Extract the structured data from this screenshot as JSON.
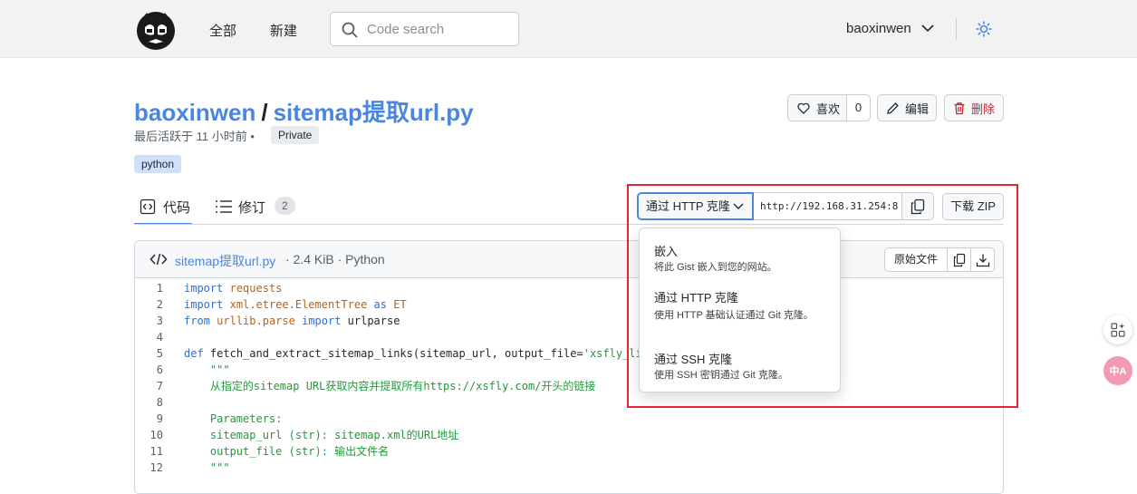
{
  "header": {
    "nav": [
      "全部",
      "新建"
    ],
    "search_placeholder": "Code search",
    "username": "baoxinwen"
  },
  "gist": {
    "owner": "baoxinwen",
    "separator": "/",
    "filename": "sitemap提取url.py",
    "meta": "最后活跃于 11 小时前 •",
    "visibility": "Private",
    "tag": "python",
    "star_label": "喜欢",
    "star_count": "0",
    "edit_label": "编辑",
    "delete_label": "删除"
  },
  "tabs": {
    "code_label": "代码",
    "revisions_label": "修订",
    "revisions_count": "2"
  },
  "clone": {
    "selected": "通过 HTTP 克隆",
    "url": "http://192.168.31.254:8",
    "zip_label": "下载 ZIP",
    "menu": [
      {
        "title": "嵌入",
        "desc": "将此 Gist 嵌入到您的网站。"
      },
      {
        "title": "通过 HTTP 克隆",
        "desc": "使用 HTTP 基础认证通过 Git 克隆。"
      },
      {
        "title": "通过 SSH 克隆",
        "desc": "使用 SSH 密钥通过 Git 克隆。"
      }
    ]
  },
  "file": {
    "name": "sitemap提取url.py",
    "info": "· 2.4 KiB · Python",
    "raw_label": "原始文件"
  },
  "code_lines": [
    "import requests",
    "import xml.etree.ElementTree as ET",
    "from urllib.parse import urlparse",
    "",
    "def fetch_and_extract_sitemap_links(sitemap_url, output_file='xsfly_links",
    "    \"\"\"",
    "    从指定的sitemap URL获取内容并提取所有https://xsfly.com/开头的链接",
    "",
    "    Parameters:",
    "    sitemap_url (str): sitemap.xml的URL地址",
    "    output_file (str): 输出文件名",
    "    \"\"\""
  ],
  "side": {
    "translate_label": "中A"
  },
  "colors": {
    "accent": "#4a86de",
    "danger": "#cf222e",
    "highlight": "#e3262f"
  }
}
